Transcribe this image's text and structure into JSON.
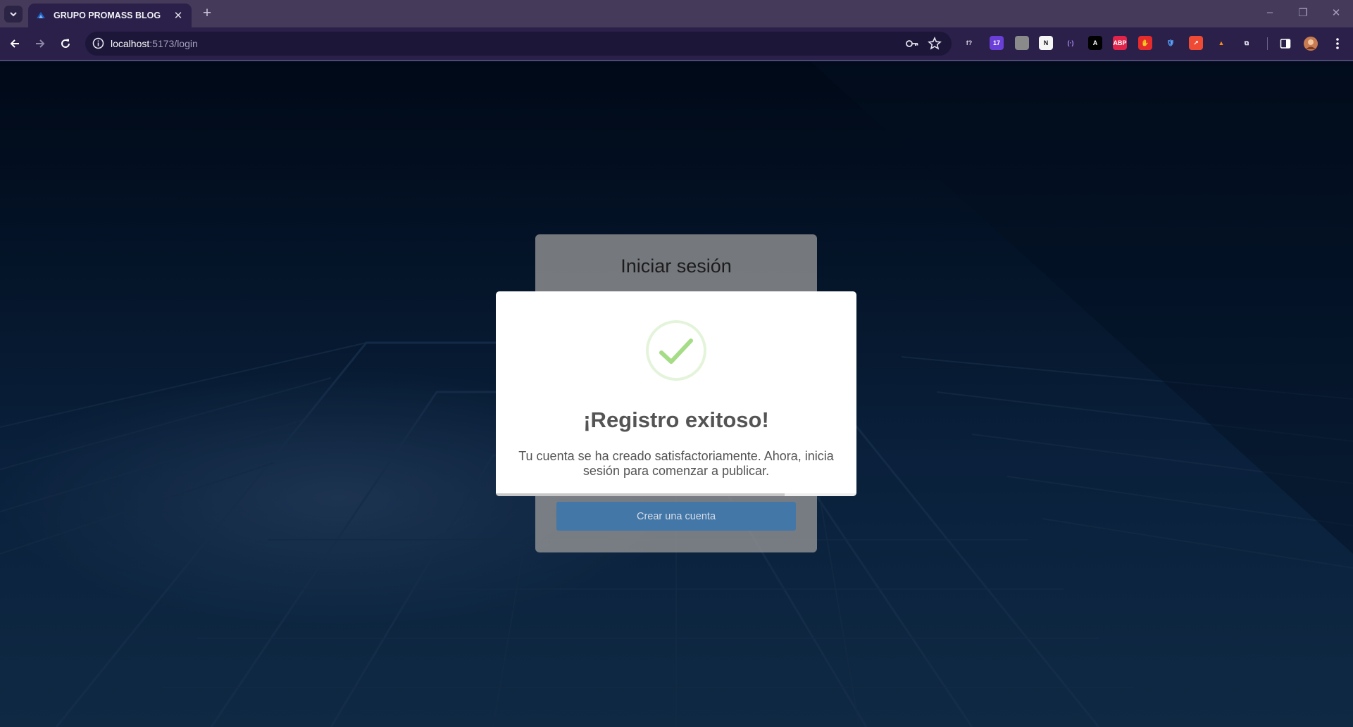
{
  "browser": {
    "tab_title": "GRUPO PROMASS BLOG",
    "tab_close_glyph": "✕",
    "new_tab_glyph": "+",
    "url_host": "localhost",
    "url_rest": ":5173/login",
    "window_controls": [
      "–",
      "❐",
      "✕"
    ],
    "extensions": [
      {
        "name": "formula-extension-icon",
        "glyph": "f?",
        "bg": "transparent",
        "color": "#d9d6e6"
      },
      {
        "name": "calendar-extension-icon",
        "glyph": "17",
        "bg": "#6a3fd8",
        "color": "#ffffff"
      },
      {
        "name": "pin-extension-icon",
        "glyph": "",
        "bg": "#8a8a8a",
        "color": "#ffffff"
      },
      {
        "name": "notion-extension-icon",
        "glyph": "N",
        "bg": "#f5f5f5",
        "color": "#111111"
      },
      {
        "name": "code-extension-icon",
        "glyph": "(·)",
        "bg": "transparent",
        "color": "#b58cff"
      },
      {
        "name": "font-extension-icon",
        "glyph": "A",
        "bg": "#000000",
        "color": "#ffffff"
      },
      {
        "name": "adblock-extension-icon",
        "glyph": "ABP",
        "bg": "#e2234a",
        "color": "#ffffff"
      },
      {
        "name": "hand-extension-icon",
        "glyph": "✋",
        "bg": "#e52b2b",
        "color": "#ffffff"
      },
      {
        "name": "shield-extension-icon",
        "glyph": "🛡",
        "bg": "transparent",
        "color": "#58a6ff"
      },
      {
        "name": "arrow-extension-icon",
        "glyph": "↗",
        "bg": "#ef4b34",
        "color": "#ffffff"
      },
      {
        "name": "mascot-extension-icon",
        "glyph": "▲",
        "bg": "transparent",
        "color": "#ff8a1f"
      },
      {
        "name": "extensions-puzzle-icon",
        "glyph": "⧉",
        "bg": "transparent",
        "color": "#e4e1ee"
      }
    ]
  },
  "login": {
    "heading": "Iniciar sesión",
    "create_account_label": "Crear una cuenta"
  },
  "modal": {
    "title": "¡Registro exitoso!",
    "message": "Tu cuenta se ha creado satisfactoriamente. Ahora, inicia sesión para comenzar a publicar.",
    "timer_progress_percent": 80,
    "colors": {
      "check": "#a5dc86",
      "check_ring": "rgba(165,220,134,0.3)"
    }
  }
}
